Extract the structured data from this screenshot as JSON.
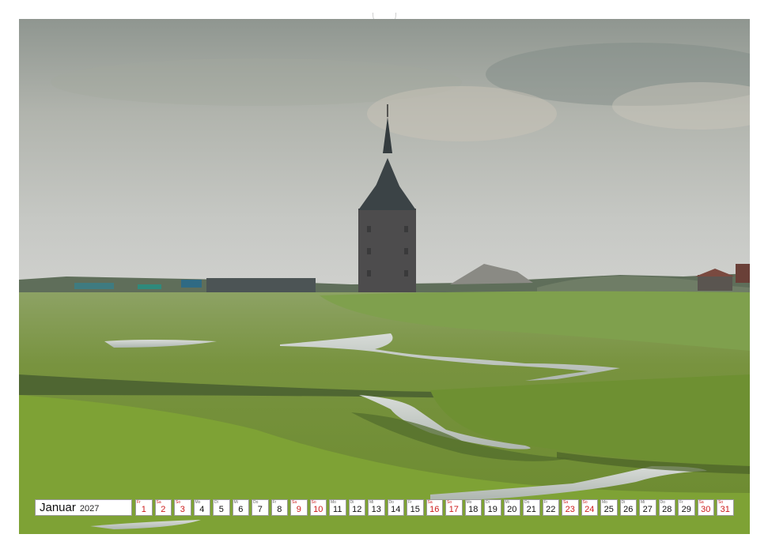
{
  "calendar": {
    "month": "Januar",
    "year": "2027",
    "weekend_color": "#cc1b1b",
    "days": [
      {
        "wd": "Fr",
        "n": "1",
        "red": true
      },
      {
        "wd": "Sa",
        "n": "2",
        "red": true
      },
      {
        "wd": "So",
        "n": "3",
        "red": true
      },
      {
        "wd": "Mo",
        "n": "4",
        "red": false
      },
      {
        "wd": "Di",
        "n": "5",
        "red": false
      },
      {
        "wd": "Mi",
        "n": "6",
        "red": false
      },
      {
        "wd": "Do",
        "n": "7",
        "red": false
      },
      {
        "wd": "Fr",
        "n": "8",
        "red": false
      },
      {
        "wd": "Sa",
        "n": "9",
        "red": true
      },
      {
        "wd": "So",
        "n": "10",
        "red": true
      },
      {
        "wd": "Mo",
        "n": "11",
        "red": false
      },
      {
        "wd": "Di",
        "n": "12",
        "red": false
      },
      {
        "wd": "Mi",
        "n": "13",
        "red": false
      },
      {
        "wd": "Do",
        "n": "14",
        "red": false
      },
      {
        "wd": "Fr",
        "n": "15",
        "red": false
      },
      {
        "wd": "Sa",
        "n": "16",
        "red": true
      },
      {
        "wd": "So",
        "n": "17",
        "red": true
      },
      {
        "wd": "Mo",
        "n": "18",
        "red": false
      },
      {
        "wd": "Di",
        "n": "19",
        "red": false
      },
      {
        "wd": "Mi",
        "n": "20",
        "red": false
      },
      {
        "wd": "Do",
        "n": "21",
        "red": false
      },
      {
        "wd": "Fr",
        "n": "22",
        "red": false
      },
      {
        "wd": "Sa",
        "n": "23",
        "red": true
      },
      {
        "wd": "So",
        "n": "24",
        "red": true
      },
      {
        "wd": "Mo",
        "n": "25",
        "red": false
      },
      {
        "wd": "Di",
        "n": "26",
        "red": false
      },
      {
        "wd": "Mi",
        "n": "27",
        "red": false
      },
      {
        "wd": "Do",
        "n": "28",
        "red": false
      },
      {
        "wd": "Fr",
        "n": "29",
        "red": false
      },
      {
        "wd": "Sa",
        "n": "30",
        "red": true
      },
      {
        "wd": "So",
        "n": "31",
        "red": true
      }
    ]
  }
}
